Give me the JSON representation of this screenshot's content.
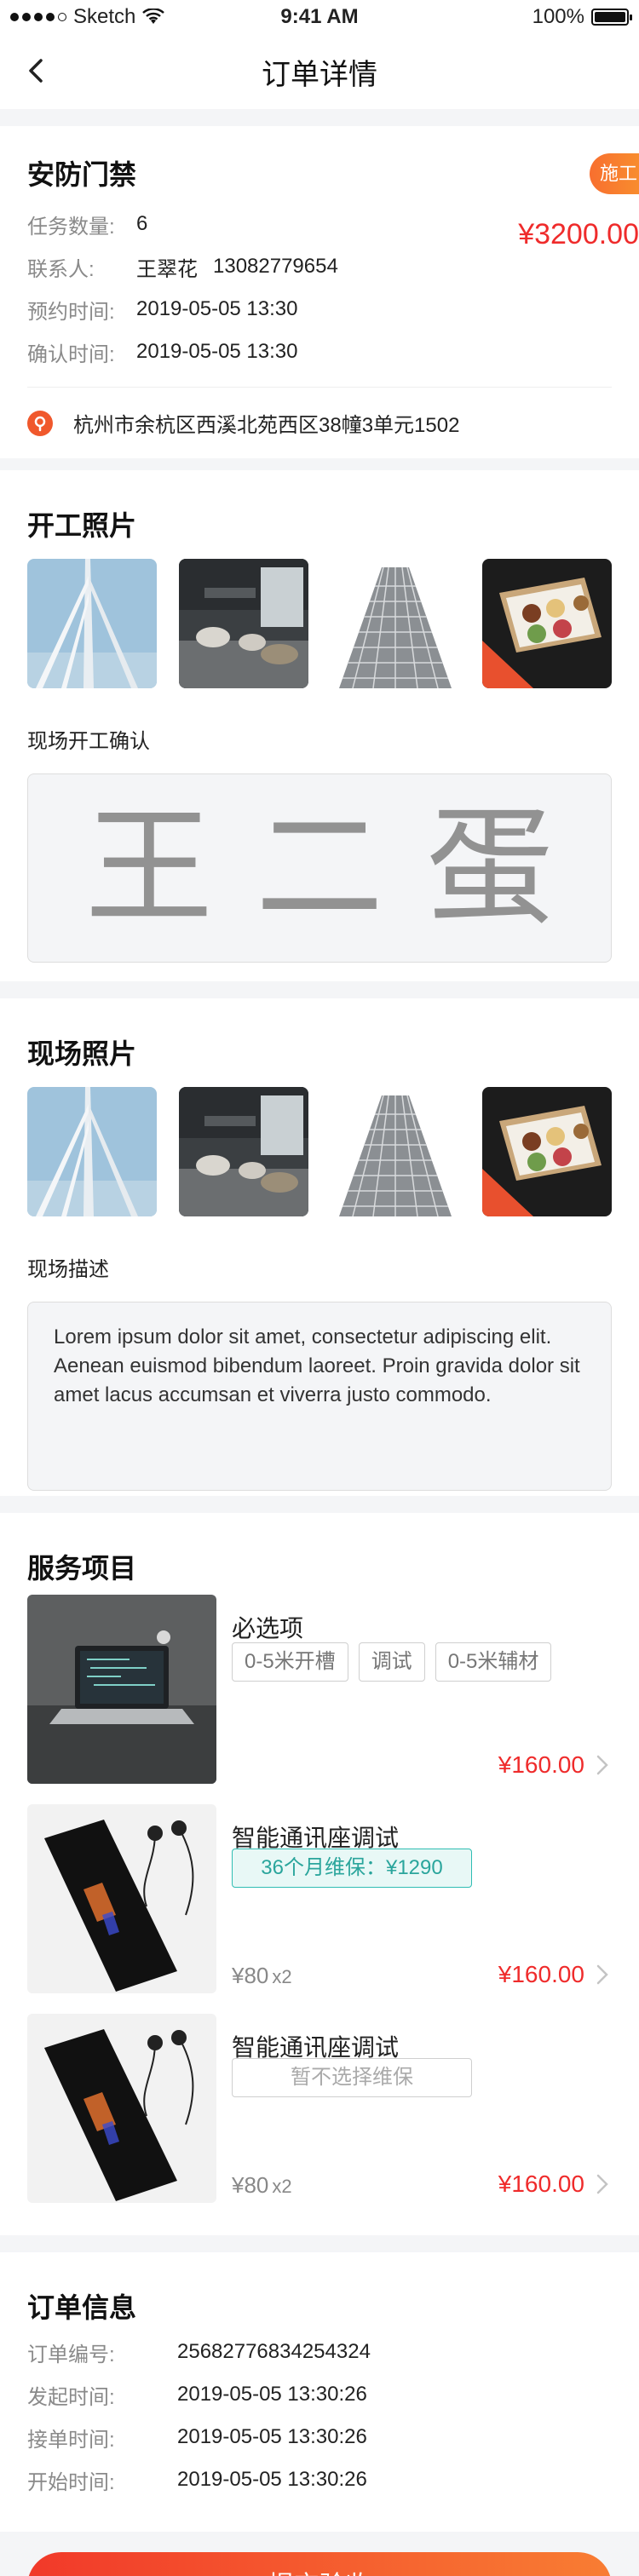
{
  "status_bar": {
    "carrier": "Sketch",
    "time": "9:41 AM",
    "battery": "100%"
  },
  "nav": {
    "title": "订单详情"
  },
  "project": {
    "title": "安防门禁",
    "status": "施工中",
    "price": "¥3200.00",
    "task_count_label": "任务数量:",
    "task_count": "6",
    "contact_label": "联系人:",
    "contact_name": "王翠花",
    "contact_phone": "13082779654",
    "appointment_label": "预约时间:",
    "appointment_time": "2019-05-05 13:30",
    "confirm_label": "确认时间:",
    "confirm_time": "2019-05-05 13:30",
    "address": "杭州市余杭区西溪北苑西区38幢3单元1502"
  },
  "start_photos": {
    "title": "开工照片",
    "images": [
      "bridge-pylon-photo",
      "office-lounge-photo",
      "building-facade-photo",
      "food-box-photo"
    ],
    "confirm_label": "现场开工确认",
    "signature": "王二蛋"
  },
  "site_photos": {
    "title": "现场照片",
    "images": [
      "bridge-pylon-photo",
      "office-lounge-photo",
      "building-facade-photo",
      "food-box-photo"
    ],
    "desc_label": "现场描述",
    "description": "Lorem ipsum dolor sit amet, consectetur adipiscing elit. Aenean euismod bibendum laoreet. Proin gravida dolor sit amet lacus accumsan et viverra justo commodo."
  },
  "services": {
    "title": "服务项目",
    "items": [
      {
        "name": "必选项",
        "image": "laptop-photo",
        "options": [
          "0-5米开槽",
          "调试",
          "0-5米辅材"
        ],
        "price": "¥160.00"
      },
      {
        "name": "智能通讯座调试",
        "image": "phone-earbuds-photo",
        "warranty": "36个月维保：¥1290",
        "unit_price": "¥80",
        "qty": "x2",
        "price": "¥160.00"
      },
      {
        "name": "智能通讯座调试",
        "image": "phone-earbuds-photo",
        "warranty": "暂不选择维保",
        "unit_price": "¥80",
        "qty": "x2",
        "price": "¥160.00"
      }
    ]
  },
  "order_info": {
    "title": "订单信息",
    "rows": [
      {
        "label": "订单编号:",
        "value": "25682776834254324"
      },
      {
        "label": "发起时间:",
        "value": "2019-05-05 13:30:26"
      },
      {
        "label": "接单时间:",
        "value": "2019-05-05 13:30:26"
      },
      {
        "label": "开始时间:",
        "value": "2019-05-05 13:30:26"
      }
    ]
  },
  "submit": {
    "label": "提交验收"
  },
  "colors": {
    "accent_red": "#ef2b2b",
    "tag_orange": "#f86f2f",
    "teal": "#2fbdb3"
  }
}
